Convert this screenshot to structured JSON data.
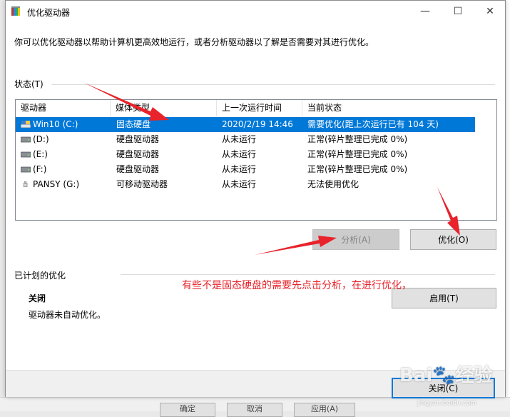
{
  "window": {
    "title": "优化驱动器",
    "minimize": "—",
    "maximize": "☐",
    "close": "✕"
  },
  "intro_text": "你可以优化驱动器以帮助计算机更高效地运行，或者分析驱动器以了解是否需要对其进行优化。",
  "status": {
    "label": "状态(T)",
    "columns": [
      "驱动器",
      "媒体类型",
      "上一次运行时间",
      "当前状态"
    ],
    "rows": [
      {
        "drive": "Win10 (C:)",
        "media": "固态硬盘",
        "last_run": "2020/2/19 14:46",
        "state": "需要优化(距上次运行已有 104 天)",
        "icon": "ssd-drive-icon",
        "selected": true
      },
      {
        "drive": "(D:)",
        "media": "硬盘驱动器",
        "last_run": "从未运行",
        "state": "正常(碎片整理已完成 0%)",
        "icon": "hard-drive-icon"
      },
      {
        "drive": "(E:)",
        "media": "硬盘驱动器",
        "last_run": "从未运行",
        "state": "正常(碎片整理已完成 0%)",
        "icon": "hard-drive-icon"
      },
      {
        "drive": "(F:)",
        "media": "硬盘驱动器",
        "last_run": "从未运行",
        "state": "正常(碎片整理已完成 0%)",
        "icon": "hard-drive-icon"
      },
      {
        "drive": "PANSY (G:)",
        "media": "可移动驱动器",
        "last_run": "从未运行",
        "state": "无法使用优化",
        "icon": "usb-drive-icon"
      }
    ]
  },
  "buttons": {
    "analyze": "分析(A)",
    "optimize": "优化(O)",
    "enable": "启用(T)",
    "close": "关闭(C)"
  },
  "schedule": {
    "label": "已计划的优化",
    "state": "关闭",
    "description": "驱动器未自动优化。"
  },
  "annotation": "有些不是固态硬盘的需要先点击分析，在进行优化，",
  "background_buttons": [
    "确定",
    "取消",
    "应用(A)"
  ],
  "watermark": {
    "brand": "Bai🐾经验",
    "url": "jingyan.baidu.com"
  },
  "colors": {
    "selection": "#0078d7",
    "annotation": "#e8232b",
    "default_button_border": "#0078d7"
  }
}
